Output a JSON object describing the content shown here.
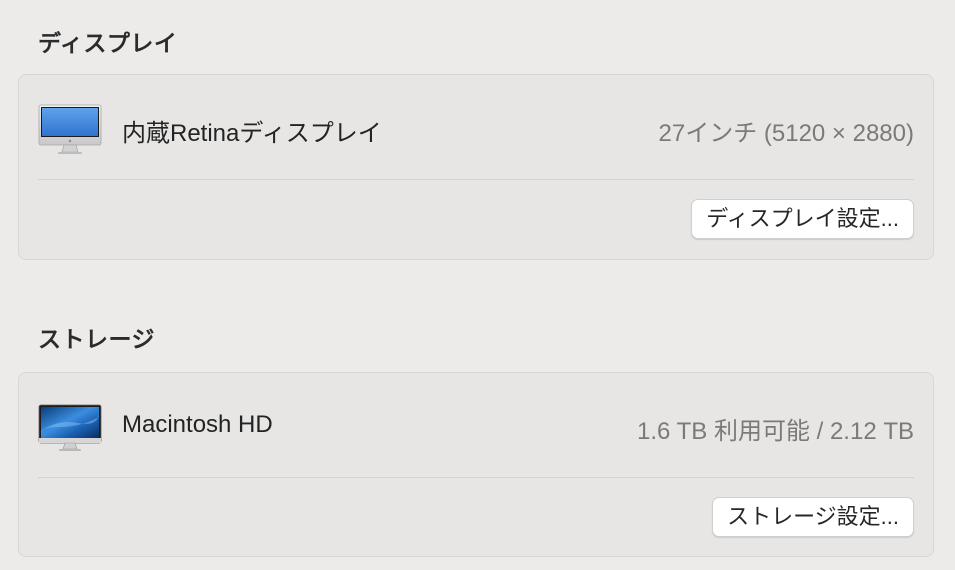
{
  "display_section": {
    "title": "ディスプレイ",
    "item": {
      "icon": "imac-display-icon",
      "label": "内蔵Retinaディスプレイ",
      "value": "27インチ (5120 × 2880)"
    },
    "button_label": "ディスプレイ設定..."
  },
  "storage_section": {
    "title": "ストレージ",
    "item": {
      "icon": "hard-drive-display-icon",
      "label": "Macintosh HD",
      "value": "1.6 TB 利用可能 / 2.12 TB"
    },
    "button_label": "ストレージ設定..."
  },
  "colors": {
    "window_background": "#ecebea",
    "panel_background": "#e7e6e5",
    "secondary_text": "#7a7a7a",
    "button_background": "#ffffff"
  }
}
